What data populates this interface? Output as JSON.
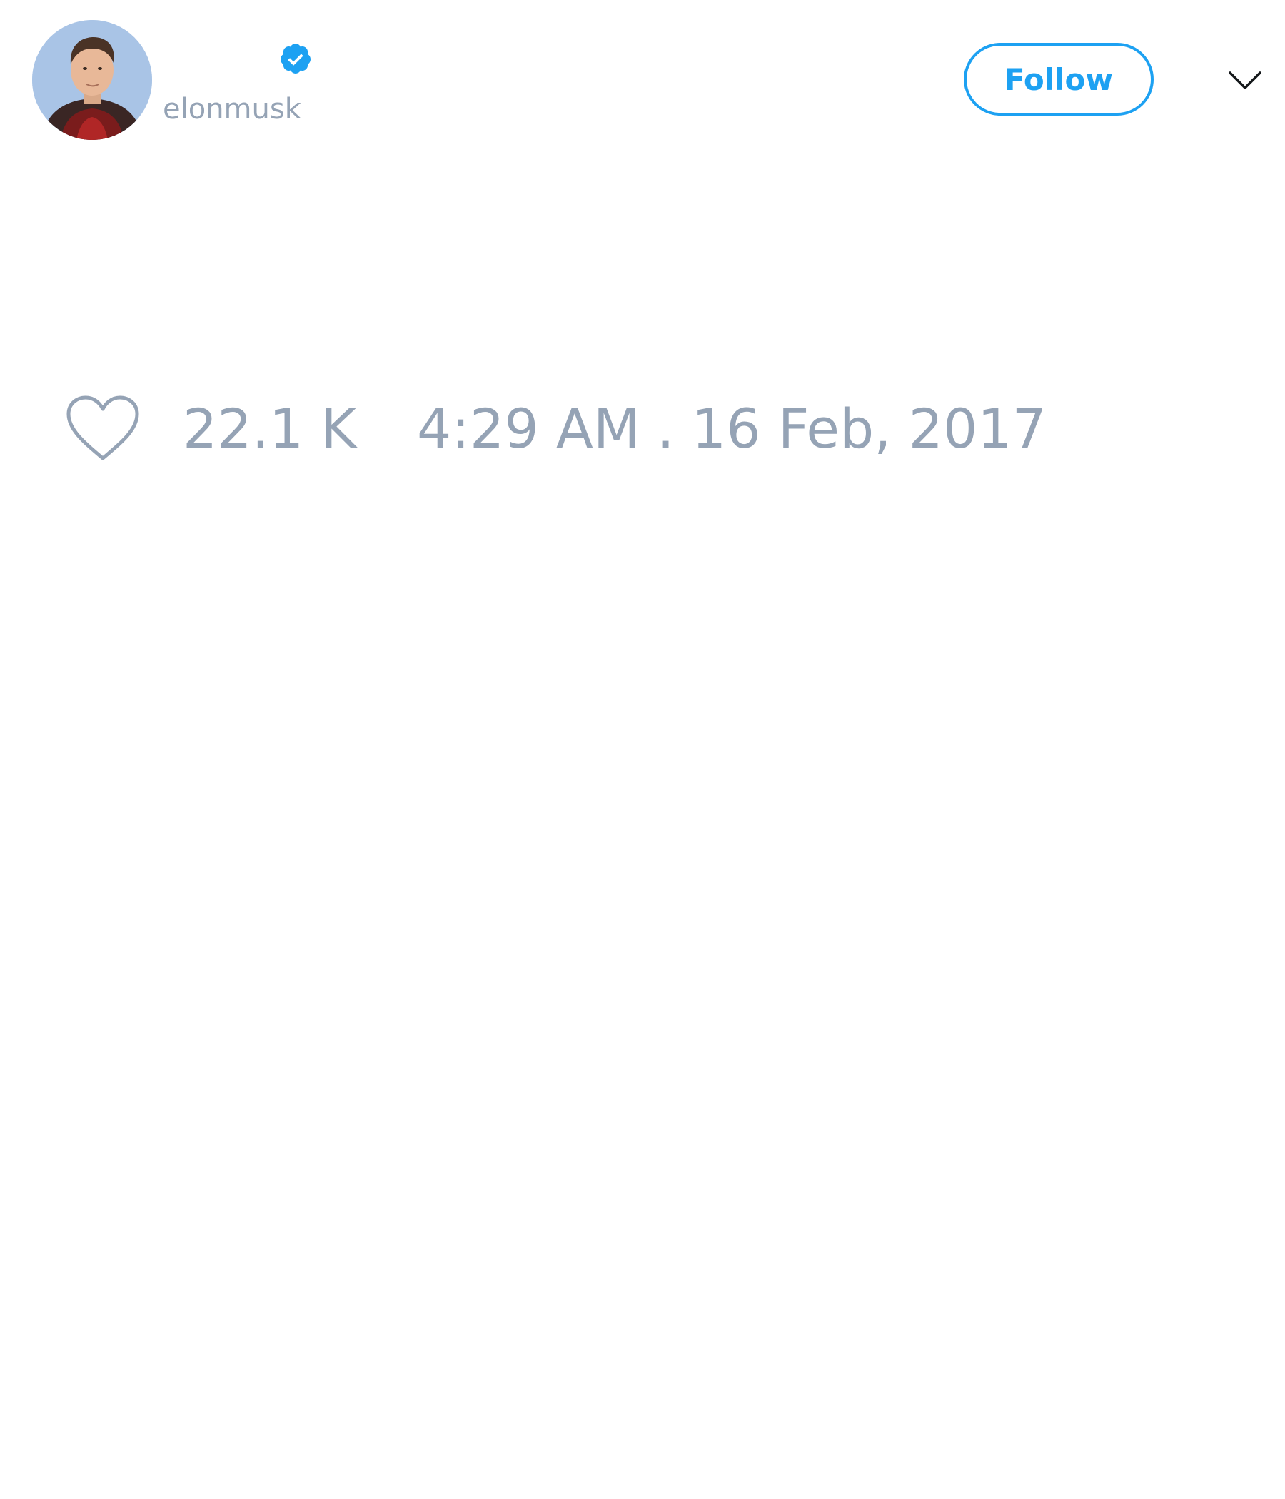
{
  "author": {
    "display_name": "",
    "handle": "elonmusk",
    "verified": true
  },
  "actions": {
    "follow_label": "Follow"
  },
  "engagement": {
    "likes": "22.1 K"
  },
  "meta": {
    "timestamp": "4:29 AM . 16 Feb, 2017"
  },
  "colors": {
    "accent": "#1da1f2",
    "muted_text": "#95a3b5",
    "background": "#ffffff"
  },
  "icons": {
    "verified": "verified-badge-icon",
    "more": "chevron-down-icon",
    "like": "heart-outline-icon"
  }
}
